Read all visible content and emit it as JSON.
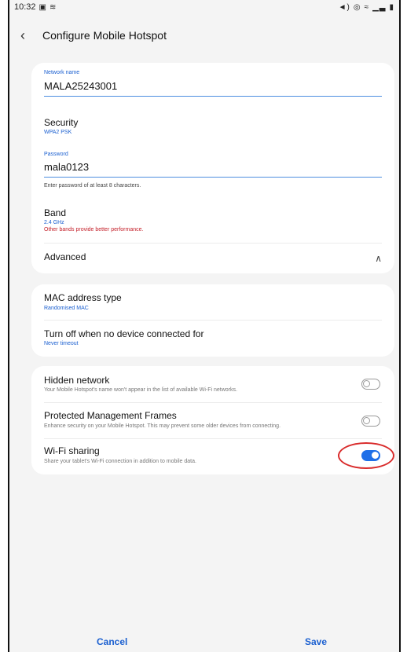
{
  "status_bar": {
    "time": "10:32",
    "left_icons": [
      "gallery-icon",
      "hotspot-icon"
    ],
    "right_icons": [
      "mute-icon",
      "hotspot-active-icon",
      "wifi-icon",
      "signal-icon",
      "battery-icon"
    ]
  },
  "header": {
    "back_icon": "back-chevron-icon",
    "title": "Configure Mobile Hotspot"
  },
  "network": {
    "name_label": "Network name",
    "name_value": "MALA25243001",
    "security_title": "Security",
    "security_value": "WPA2 PSK",
    "password_label": "Password",
    "password_value": "mala0123",
    "password_helper": "Enter password of at least 8 characters.",
    "band_title": "Band",
    "band_value": "2.4 GHz",
    "band_warning": "Other bands provide better performance.",
    "advanced_label": "Advanced"
  },
  "advanced": {
    "mac_title": "MAC address type",
    "mac_value": "Randomised MAC",
    "timeout_title": "Turn off when no device connected for",
    "timeout_value": "Never timeout"
  },
  "toggles": {
    "hidden_title": "Hidden network",
    "hidden_desc": "Your Mobile Hotspot's name won't appear in the list of available Wi-Fi networks.",
    "hidden_on": false,
    "pmf_title": "Protected Management Frames",
    "pmf_desc": "Enhance security on your Mobile Hotspot. This may prevent some older devices from connecting.",
    "pmf_on": false,
    "wifi_sharing_title": "Wi-Fi sharing",
    "wifi_sharing_desc": "Share your tablet's Wi-Fi connection in addition to mobile data.",
    "wifi_sharing_on": true
  },
  "footer": {
    "cancel": "Cancel",
    "save": "Save"
  },
  "colors": {
    "accent": "#1e6fe8",
    "warning": "#c4202a",
    "highlight": "#d92b2b"
  }
}
